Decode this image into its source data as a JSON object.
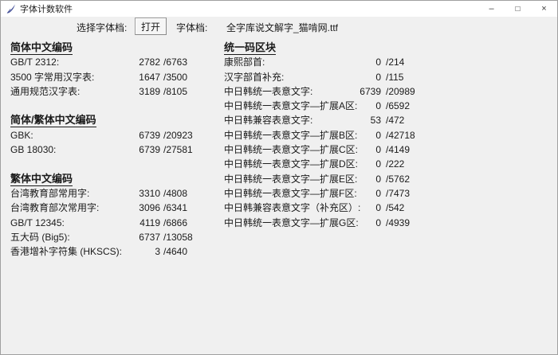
{
  "window": {
    "title": "字体计数软件",
    "icons": {
      "minimize": "–",
      "maximize": "□",
      "close": "×"
    }
  },
  "toolbar": {
    "select_font_label": "选择字体档:",
    "open_button": "打开",
    "font_file_label": "字体档:",
    "font_file_name": "全字库说文解字_猫啃网.ttf"
  },
  "columns": {
    "left": [
      {
        "title": "简体中文编码",
        "rows": [
          {
            "label": "GB/T 2312:",
            "value": "2782",
            "total": "/6763"
          },
          {
            "label": "3500 字常用汉字表:",
            "value": "1647",
            "total": "/3500"
          },
          {
            "label": "通用规范汉字表:",
            "value": "3189",
            "total": "/8105"
          }
        ]
      },
      {
        "title": "简体/繁体中文编码",
        "rows": [
          {
            "label": "GBK:",
            "value": "6739",
            "total": "/20923"
          },
          {
            "label": "GB 18030:",
            "value": "6739",
            "total": "/27581"
          }
        ]
      },
      {
        "title": "繁体中文编码",
        "rows": [
          {
            "label": "台湾教育部常用字:",
            "value": "3310",
            "total": "/4808"
          },
          {
            "label": "台湾教育部次常用字:",
            "value": "3096",
            "total": "/6341"
          },
          {
            "label": "GB/T 12345:",
            "value": "4119",
            "total": "/6866"
          },
          {
            "label": "五大码 (Big5):",
            "value": "6737",
            "total": "/13058"
          },
          {
            "label": "香港增补字符集 (HKSCS):",
            "value": "3",
            "total": "/4640"
          }
        ]
      }
    ],
    "right": [
      {
        "title": "统一码区块",
        "rows": [
          {
            "label": "康熙部首:",
            "value": "0",
            "total": "/214"
          },
          {
            "label": "汉字部首补充:",
            "value": "0",
            "total": "/115"
          },
          {
            "label": "中日韩统一表意文字:",
            "value": "6739",
            "total": "/20989"
          },
          {
            "label": "中日韩统一表意文字—扩展A区:",
            "value": "0",
            "total": "/6592"
          },
          {
            "label": "中日韩兼容表意文字:",
            "value": "53",
            "total": "/472"
          },
          {
            "label": "中日韩统一表意文字—扩展B区:",
            "value": "0",
            "total": "/42718"
          },
          {
            "label": "中日韩统一表意文字—扩展C区:",
            "value": "0",
            "total": "/4149"
          },
          {
            "label": "中日韩统一表意文字—扩展D区:",
            "value": "0",
            "total": "/222"
          },
          {
            "label": "中日韩统一表意文字—扩展E区:",
            "value": "0",
            "total": "/5762"
          },
          {
            "label": "中日韩统一表意文字—扩展F区:",
            "value": "0",
            "total": "/7473"
          },
          {
            "label": "中日韩兼容表意文字（补充区）:",
            "value": "0",
            "total": "/542"
          },
          {
            "label": "中日韩统一表意文字—扩展G区:",
            "value": "0",
            "total": "/4939"
          }
        ]
      }
    ]
  },
  "colors": {
    "window_bg": "#f0f0f0",
    "titlebar_bg": "#ffffff",
    "text": "#1a1a1a",
    "border": "#9f9f9f",
    "feather_icon_blue": "#3b4793"
  }
}
